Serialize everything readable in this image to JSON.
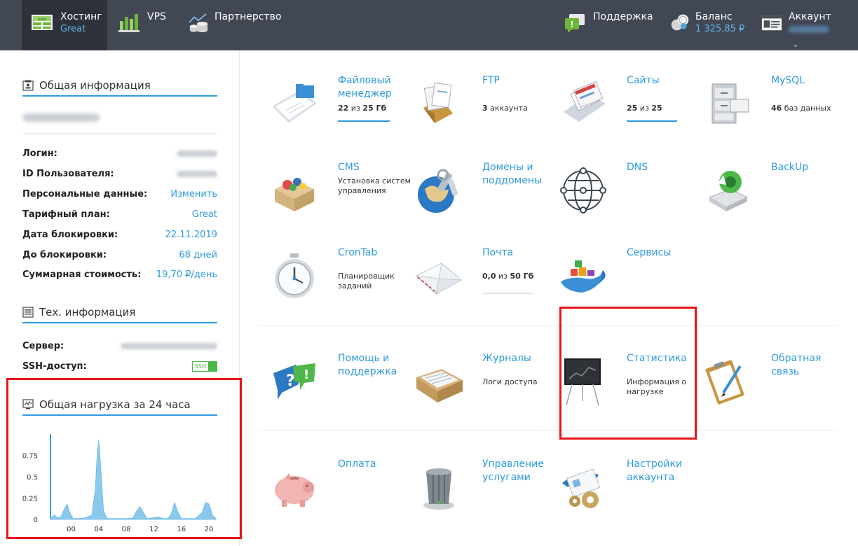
{
  "topbar": {
    "hosting": {
      "title": "Хостинг",
      "sub": "Great"
    },
    "vps": {
      "title": "VPS"
    },
    "partner": {
      "title": "Партнерство"
    },
    "support": {
      "title": "Поддержка"
    },
    "balance": {
      "title": "Баланс",
      "sub": "1 325,85 ₽"
    },
    "account": {
      "title": "Аккаунт",
      "chevron": "⌄"
    }
  },
  "sidebar": {
    "general_title": "Общая информация",
    "rows": [
      {
        "label": "Логин:",
        "value": ""
      },
      {
        "label": "ID Пользователя:",
        "value": ""
      },
      {
        "label": "Персональные данные:",
        "value": "Изменить"
      },
      {
        "label": "Тарифный план:",
        "value": "Great"
      },
      {
        "label": "Дата блокировки:",
        "value": "22.11.2019"
      },
      {
        "label": "До блокировки:",
        "value": "68 дней"
      },
      {
        "label": "Суммарная стоимость:",
        "value": "19,70 ₽/день"
      }
    ],
    "tech_title": "Тех. информация",
    "tech_rows": [
      {
        "label": "Сервер:",
        "value": ""
      },
      {
        "label": "SSH-доступ:",
        "value": "SSH"
      }
    ],
    "load_title": "Общая нагрузка за 24 часа"
  },
  "chart_data": {
    "type": "area",
    "title": "Общая нагрузка за 24 часа",
    "x_ticks": [
      "00",
      "04",
      "08",
      "12",
      "16",
      "20"
    ],
    "y_ticks": [
      "0",
      "0.25",
      "0.5",
      "0.75"
    ],
    "ylim": [
      0,
      1
    ],
    "points": [
      [
        -3,
        0.02
      ],
      [
        -2.4,
        0.05
      ],
      [
        -2,
        0.02
      ],
      [
        -1.5,
        0.03
      ],
      [
        -1,
        0.12
      ],
      [
        -0.6,
        0.18
      ],
      [
        -0.2,
        0.08
      ],
      [
        0.3,
        0.01
      ],
      [
        1,
        0.01
      ],
      [
        2,
        0.02
      ],
      [
        3,
        0.05
      ],
      [
        3.5,
        0.35
      ],
      [
        3.8,
        0.8
      ],
      [
        4,
        0.93
      ],
      [
        4.3,
        0.6
      ],
      [
        4.7,
        0.1
      ],
      [
        5.2,
        0.01
      ],
      [
        6,
        0.01
      ],
      [
        7,
        0.01
      ],
      [
        8,
        0.01
      ],
      [
        9,
        0.02
      ],
      [
        9.5,
        0.1
      ],
      [
        10,
        0.15
      ],
      [
        10.5,
        0.08
      ],
      [
        11,
        0.01
      ],
      [
        12,
        0.02
      ],
      [
        12.6,
        0.03
      ],
      [
        13.4,
        0.01
      ],
      [
        14,
        0.01
      ],
      [
        14.5,
        0.06
      ],
      [
        15,
        0.2
      ],
      [
        15.4,
        0.1
      ],
      [
        16,
        0.01
      ],
      [
        17,
        0.01
      ],
      [
        18,
        0.01
      ],
      [
        19,
        0.08
      ],
      [
        19.5,
        0.2
      ],
      [
        20,
        0.18
      ],
      [
        20.5,
        0.05
      ],
      [
        21,
        0.01
      ]
    ],
    "grid": false,
    "color": "#89c9ec"
  },
  "tiles": [
    {
      "id": "file-manager",
      "title": "Файловый менеджер",
      "desc_html": "22 из 25 Гб",
      "bold": [
        "22",
        "25 Гб"
      ],
      "bar": true
    },
    {
      "id": "ftp",
      "title": "FTP",
      "desc_html": "3 аккаунта",
      "bold": [
        "3"
      ]
    },
    {
      "id": "sites",
      "title": "Сайты",
      "desc_html": "25 из 25",
      "bold": [
        "25",
        "25"
      ],
      "bar": true
    },
    {
      "id": "mysql",
      "title": "MySQL",
      "desc_html": "46 баз данных",
      "bold": [
        "46"
      ]
    },
    {
      "id": "cms",
      "title": "CMS",
      "desc_html": "Установка систем управления"
    },
    {
      "id": "domains",
      "title": "Домены и поддомены"
    },
    {
      "id": "dns",
      "title": "DNS"
    },
    {
      "id": "backup",
      "title": "BackUp"
    },
    {
      "id": "crontab",
      "title": "CronTab",
      "desc_html": "Планировщик заданий"
    },
    {
      "id": "mail",
      "title": "Почта",
      "desc_html": "0,0 из 50 Гб",
      "bold": [
        "0,0",
        "50 Гб"
      ],
      "bar": true
    },
    {
      "id": "services",
      "title": "Сервисы"
    },
    {
      "id": "help",
      "title": "Помощь и поддержка"
    },
    {
      "id": "logs",
      "title": "Журналы",
      "desc_html": "Логи доступа"
    },
    {
      "id": "stats",
      "title": "Статистика",
      "desc_html": "Информация о нагрузке"
    },
    {
      "id": "feedback",
      "title": "Обратная связь"
    },
    {
      "id": "payment",
      "title": "Оплата"
    },
    {
      "id": "service-mgmt",
      "title": "Управление услугами"
    },
    {
      "id": "account-settings",
      "title": "Настройки аккаунта"
    }
  ]
}
